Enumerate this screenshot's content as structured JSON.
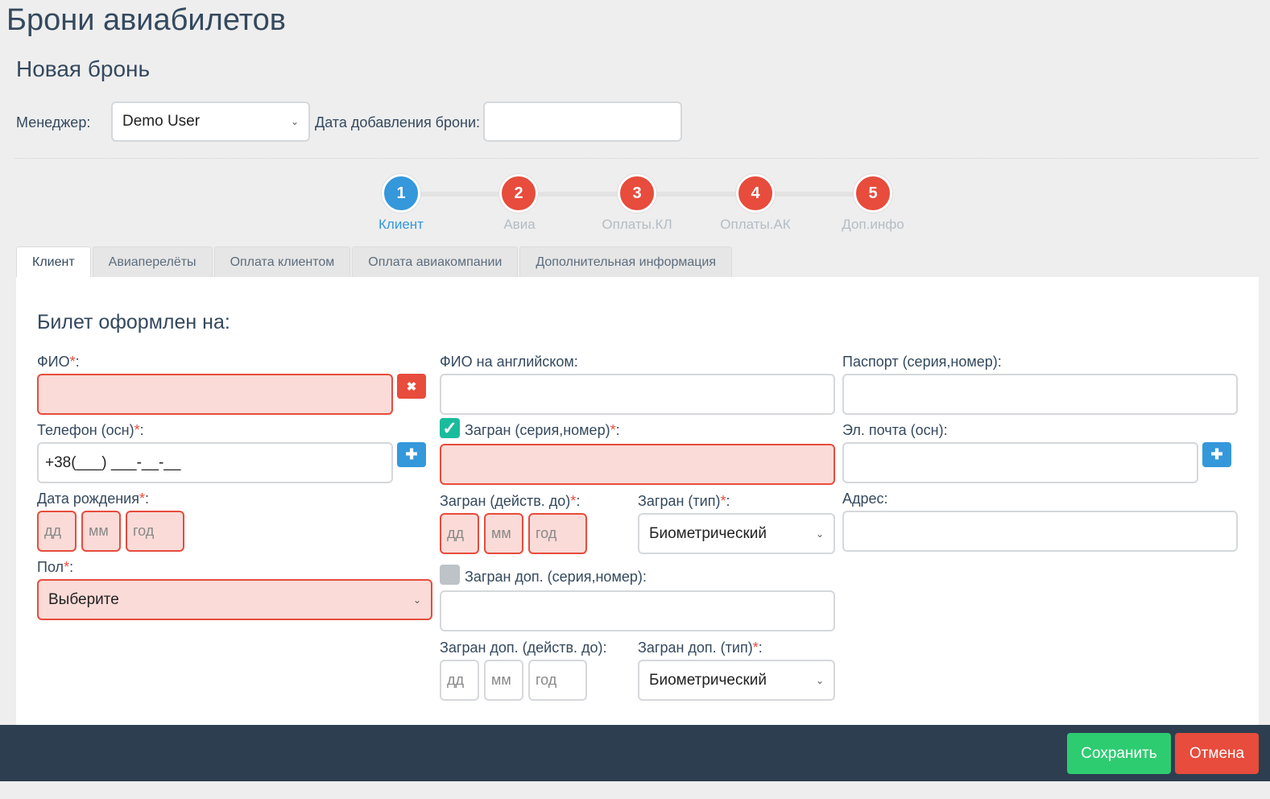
{
  "page": {
    "title": "Брони авиабилетов",
    "subtitle": "Новая бронь"
  },
  "header": {
    "manager_label": "Менеджер:",
    "manager_value": "Demo User",
    "date_label": "Дата добавления брони:",
    "date_value": ""
  },
  "steps": [
    {
      "num": "1",
      "label": "Клиент",
      "state": "active"
    },
    {
      "num": "2",
      "label": "Авиа",
      "state": "error"
    },
    {
      "num": "3",
      "label": "Оплаты.КЛ",
      "state": "error"
    },
    {
      "num": "4",
      "label": "Оплаты.АК",
      "state": "error"
    },
    {
      "num": "5",
      "label": "Доп.инфо",
      "state": "error"
    }
  ],
  "tabs": [
    {
      "label": "Клиент",
      "active": true
    },
    {
      "label": "Авиаперелёты"
    },
    {
      "label": "Оплата клиентом"
    },
    {
      "label": "Оплата авиакомпании"
    },
    {
      "label": "Дополнительная информация"
    }
  ],
  "form": {
    "section_title": "Билет оформлен на:",
    "required_mark": "*",
    "fio": {
      "label": "ФИО",
      "value": ""
    },
    "phone": {
      "label": "Телефон (осн)",
      "value": "+38(___) ___-__-__"
    },
    "birth": {
      "label": "Дата рождения",
      "day": "дд",
      "month": "мм",
      "year": "год"
    },
    "gender": {
      "label": "Пол",
      "value": "Выберите"
    },
    "fio_en": {
      "label": "ФИО на английском:",
      "value": ""
    },
    "zagran": {
      "label": "Загран (серия,номер)",
      "checked": true,
      "value": ""
    },
    "zagran_valid": {
      "label": "Загран (действ. до)",
      "day": "дд",
      "month": "мм",
      "year": "год"
    },
    "zagran_type": {
      "label": "Загран (тип)",
      "value": "Биометрический"
    },
    "zagran2": {
      "label": "Загран доп. (серия,номер):",
      "checked": false,
      "value": ""
    },
    "zagran2_valid": {
      "label": "Загран доп. (действ. до):",
      "day": "дд",
      "month": "мм",
      "year": "год"
    },
    "zagran2_type": {
      "label": "Загран доп. (тип)",
      "value": "Биометрический"
    },
    "passport": {
      "label": "Паспорт (серия,номер):",
      "value": ""
    },
    "email": {
      "label": "Эл. почта (осн):",
      "value": ""
    },
    "address": {
      "label": "Адрес:",
      "value": ""
    }
  },
  "icons": {
    "remove": "✖",
    "add": "✚",
    "check": "✓",
    "chevron": "⌄"
  },
  "footer": {
    "save_label": "Сохранить",
    "cancel_label": "Отмена"
  },
  "colors": {
    "primary": "#3498db",
    "danger": "#e74c3c",
    "success": "#2ecc71",
    "turquoise": "#1abc9c",
    "dark": "#2c3e50",
    "error_bg": "#fadbd8"
  }
}
